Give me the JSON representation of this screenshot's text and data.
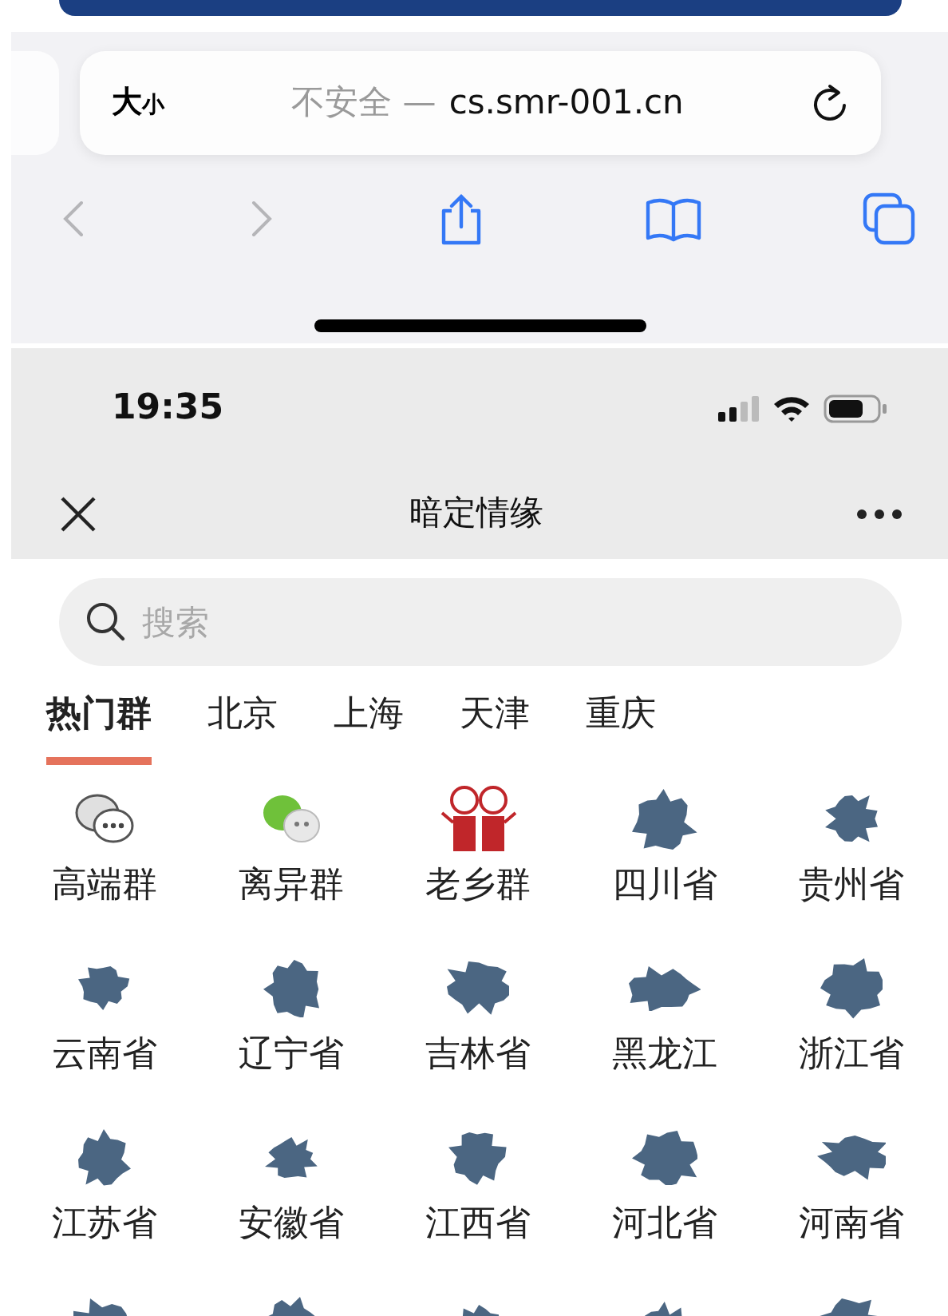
{
  "browser": {
    "text_size": {
      "large": "大",
      "small": "小"
    },
    "security": "不安全 —",
    "host": "cs.smr-001.cn",
    "toolbar": [
      {
        "kind": "back",
        "disabled": true
      },
      {
        "kind": "forward",
        "disabled": true
      },
      {
        "kind": "share",
        "disabled": false
      },
      {
        "kind": "bookmarks",
        "disabled": false
      },
      {
        "kind": "tabs",
        "disabled": false
      }
    ]
  },
  "status_bar": {
    "time": "19:35"
  },
  "nav_bar": {
    "title": "暗定情缘"
  },
  "search": {
    "placeholder": "搜索"
  },
  "tabs": [
    {
      "label": "热门群",
      "selected": true
    },
    {
      "label": "北京",
      "selected": false
    },
    {
      "label": "上海",
      "selected": false
    },
    {
      "label": "天津",
      "selected": false
    },
    {
      "label": "重庆",
      "selected": false
    }
  ],
  "groups": [
    {
      "kind": "chat-gray",
      "label": "高端群"
    },
    {
      "kind": "chat-green",
      "label": "离异群"
    },
    {
      "kind": "people",
      "label": "老乡群"
    },
    {
      "kind": "province",
      "label": "四川省"
    },
    {
      "kind": "province",
      "label": "贵州省"
    },
    {
      "kind": "province",
      "label": "云南省"
    },
    {
      "kind": "province",
      "label": "辽宁省"
    },
    {
      "kind": "province",
      "label": "吉林省"
    },
    {
      "kind": "province",
      "label": "黑龙江"
    },
    {
      "kind": "province",
      "label": "浙江省"
    },
    {
      "kind": "province",
      "label": "江苏省"
    },
    {
      "kind": "province",
      "label": "安徽省"
    },
    {
      "kind": "province",
      "label": "江西省"
    },
    {
      "kind": "province",
      "label": "河北省"
    },
    {
      "kind": "province",
      "label": "河南省"
    },
    {
      "kind": "province"
    },
    {
      "kind": "province"
    },
    {
      "kind": "province"
    },
    {
      "kind": "province"
    },
    {
      "kind": "province"
    }
  ]
}
